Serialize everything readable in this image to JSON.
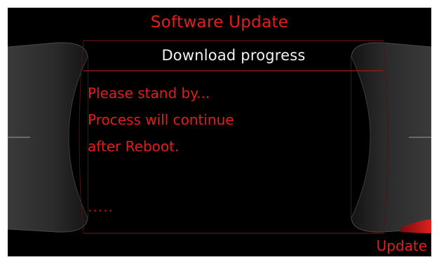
{
  "screen": {
    "title": "Software Update",
    "panel_header": "Download progress",
    "message_lines": [
      "Please stand by...",
      "Process will continue",
      "after Reboot."
    ],
    "progress_dots": ".....",
    "softkey_right": "Update"
  },
  "colors": {
    "accent_red": "#e41d1d",
    "background": "#000000",
    "header_text": "#f2f2f2"
  }
}
